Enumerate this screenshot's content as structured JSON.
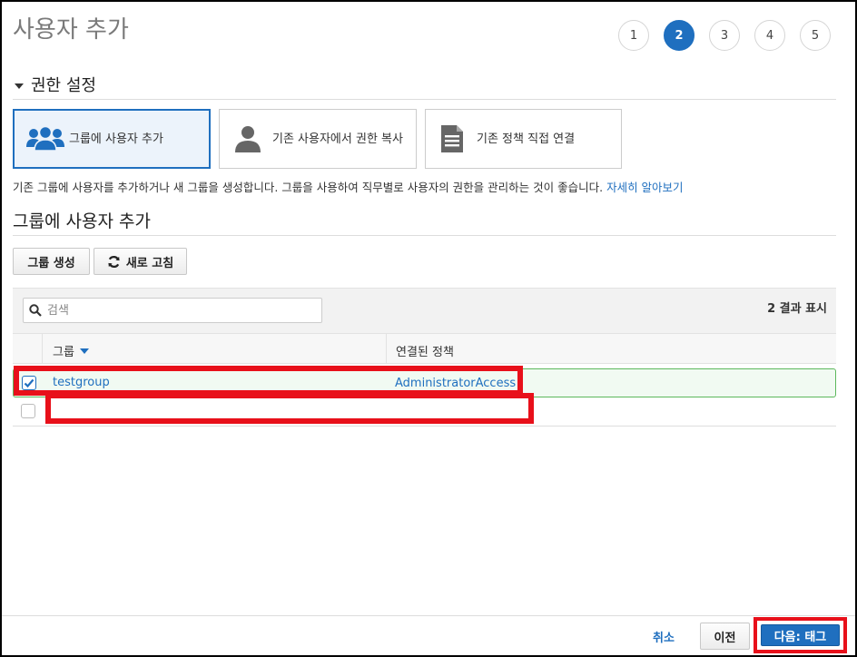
{
  "header": {
    "title": "사용자 추가",
    "steps": [
      {
        "label": "1",
        "active": false
      },
      {
        "label": "2",
        "active": true
      },
      {
        "label": "3",
        "active": false
      },
      {
        "label": "4",
        "active": false
      },
      {
        "label": "5",
        "active": false
      }
    ]
  },
  "permissions": {
    "heading": "권한 설정",
    "options": [
      {
        "label": "그룹에 사용자 추가",
        "icon": "group-icon",
        "selected": true
      },
      {
        "label": "기존 사용자에서 권한 복사",
        "icon": "user-icon",
        "selected": false
      },
      {
        "label": "기존 정책 직접 연결",
        "icon": "document-icon",
        "selected": false
      }
    ],
    "description": "기존 그룹에 사용자를 추가하거나 새 그룹을 생성합니다. 그룹을 사용하여 직무별로 사용자의 권한을 관리하는 것이 좋습니다.",
    "learn_more": "자세히 알아보기"
  },
  "groups": {
    "heading": "그룹에 사용자 추가",
    "create_button": "그룹 생성",
    "refresh_button": "새로 고침",
    "search_placeholder": "검색",
    "result_count": "2 결과 표시",
    "columns": [
      "그룹",
      "연결된 정책"
    ],
    "rows": [
      {
        "name": "testgroup",
        "policy": "AdministratorAccess",
        "checked": true
      },
      {
        "name": "",
        "policy": "",
        "checked": false
      }
    ]
  },
  "footer": {
    "cancel": "취소",
    "previous": "이전",
    "next": "다음: 태그"
  },
  "colors": {
    "accent": "#1f6fbf",
    "highlight": "#e8101a",
    "selected_row": "#5cb85c"
  }
}
